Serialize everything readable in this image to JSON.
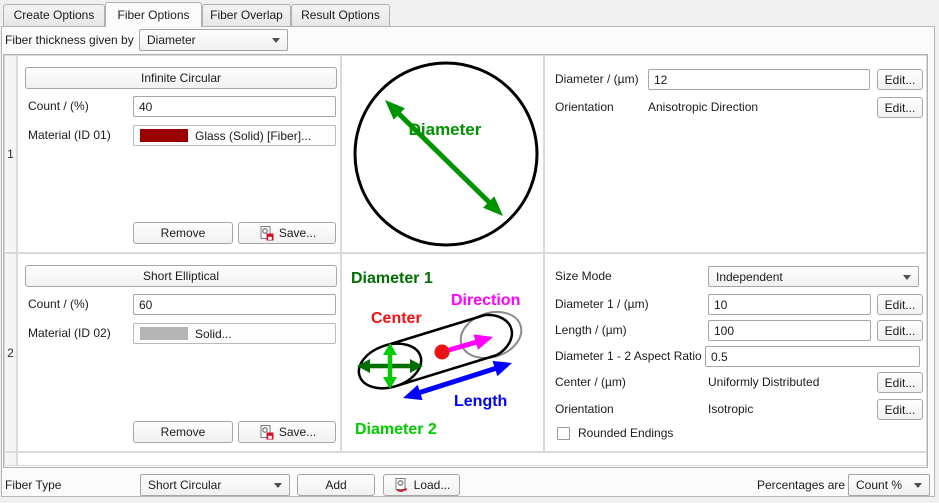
{
  "tabs": {
    "items": [
      {
        "label": "Create Options"
      },
      {
        "label": "Fiber Options"
      },
      {
        "label": "Fiber Overlap"
      },
      {
        "label": "Result Options"
      }
    ]
  },
  "header": {
    "thickness_label": "Fiber thickness given by",
    "thickness_value": "Diameter"
  },
  "table": {
    "rows": [
      {
        "index": "1",
        "shape": "Infinite Circular",
        "count_label": "Count / (%)",
        "count_value": "40",
        "material_label": "Material (ID 01)",
        "material_name": "Glass (Solid) [Fiber]...",
        "material_color": "#9b0000",
        "remove_label": "Remove",
        "save_label": "Save...",
        "diagram": {
          "labels": {
            "diameter": "Diameter"
          },
          "colors": {
            "diameter": "#009300",
            "outline": "#000000"
          }
        },
        "fields": {
          "diameter_label": "Diameter / (µm)",
          "diameter_value": "12",
          "orientation_label": "Orientation",
          "orientation_value": "Anisotropic Direction",
          "edit_label": "Edit..."
        }
      },
      {
        "index": "2",
        "shape": "Short Elliptical",
        "count_label": "Count / (%)",
        "count_value": "60",
        "material_label": "Material (ID 02)",
        "material_name": "Solid...",
        "material_color": "#b4b4b4",
        "remove_label": "Remove",
        "save_label": "Save...",
        "diagram": {
          "labels": {
            "diameter1": "Diameter 1",
            "direction": "Direction",
            "center": "Center",
            "length": "Length",
            "diameter2": "Diameter 2"
          },
          "colors": {
            "diameter1": "#006e00",
            "direction": "#ff00ff",
            "center": "#ee1111",
            "length": "#0000ff",
            "diameter2": "#00cc00",
            "outline": "#000000",
            "face": "#8a8a8a"
          }
        },
        "fields": {
          "size_mode_label": "Size Mode",
          "size_mode_value": "Independent",
          "diameter1_label": "Diameter 1 / (µm)",
          "diameter1_value": "10",
          "length_label": "Length / (µm)",
          "length_value": "100",
          "aspect_label": "Diameter 1 - 2 Aspect Ratio",
          "aspect_value": "0.5",
          "center_label": "Center / (µm)",
          "center_value": "Uniformly Distributed",
          "orientation_label": "Orientation",
          "orientation_value": "Isotropic",
          "rounded_label": "Rounded Endings",
          "rounded_checked": false,
          "edit_label": "Edit..."
        }
      }
    ]
  },
  "footer": {
    "fiber_type_label": "Fiber Type",
    "fiber_type_value": "Short Circular",
    "add_label": "Add",
    "load_label": "Load...",
    "percentages_label": "Percentages are",
    "percentages_value": "Count %"
  }
}
